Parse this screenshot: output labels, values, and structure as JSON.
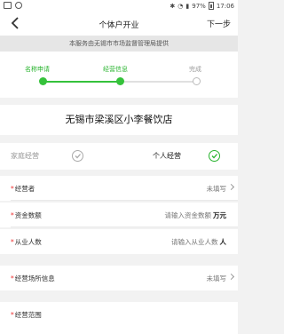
{
  "status_bar": {
    "battery": "97%",
    "time": "17:06"
  },
  "header": {
    "title": "个体户开业",
    "next_label": "下一步"
  },
  "notice": "本服务由无锡市市场监督管理局提供",
  "steps": [
    {
      "label": "名称申请",
      "state": "done"
    },
    {
      "label": "经营信息",
      "state": "current"
    },
    {
      "label": "完成",
      "state": "pending"
    }
  ],
  "company_name": "无锡市梁溪区小李餐饮店",
  "operation_type": {
    "option_family": "家庭经营",
    "option_individual": "个人经营",
    "selected": "个人经营"
  },
  "form": {
    "operator": {
      "label": "经营者",
      "value": "未填写"
    },
    "capital": {
      "label": "资金数额",
      "placeholder": "请输入资金数额",
      "unit": "万元"
    },
    "employees": {
      "label": "从业人数",
      "placeholder": "请输入从业人数",
      "unit": "人"
    },
    "premises": {
      "label": "经营场所信息",
      "value": "未填写"
    },
    "scope": {
      "label": "经营范围"
    }
  },
  "colors": {
    "accent": "#35c23b",
    "required": "#e33333"
  }
}
